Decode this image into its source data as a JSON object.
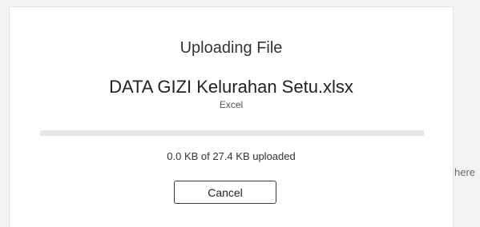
{
  "dialog": {
    "title": "Uploading File",
    "file_name": "DATA GIZI Kelurahan Setu.xlsx",
    "file_type": "Excel",
    "progress_fraction": 0.0,
    "status_text": "0.0 KB of 27.4 KB uploaded",
    "cancel_label": "Cancel"
  },
  "background": {
    "partial_text": "here"
  }
}
